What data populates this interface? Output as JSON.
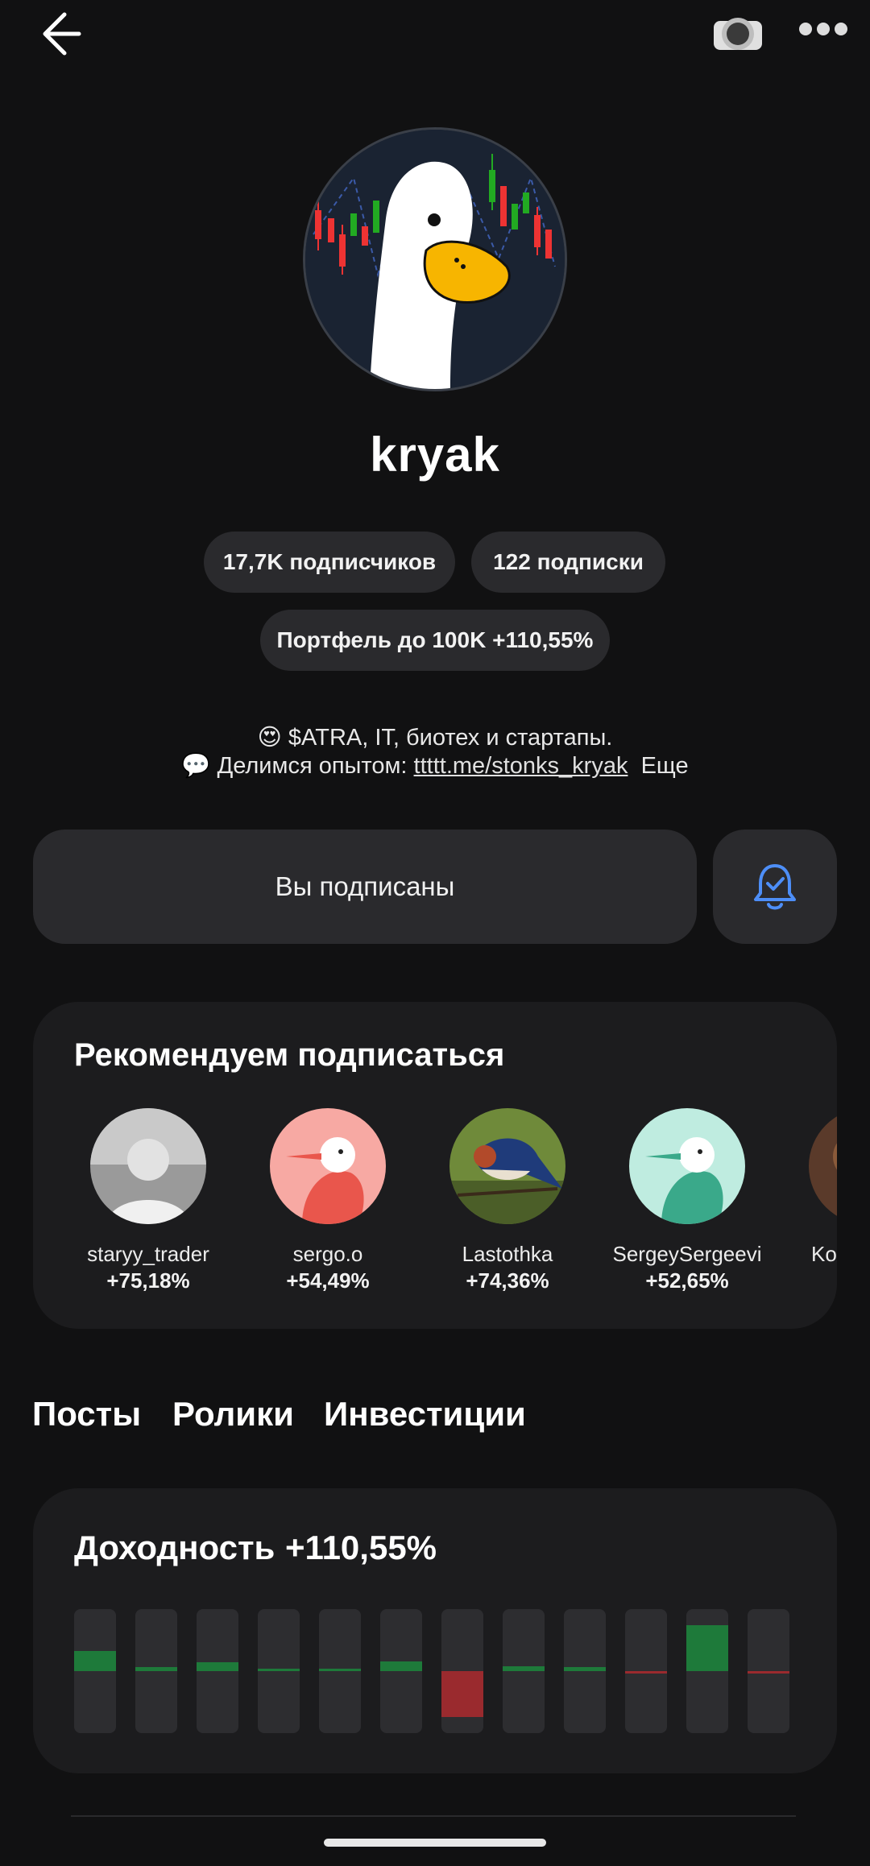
{
  "header": {
    "back_icon": "arrow-left-icon",
    "camera_icon": "camera-icon",
    "more_icon": "more-dots-icon"
  },
  "profile": {
    "username": "kryak",
    "followers": "17,7K подписчиков",
    "following": "122 подписки",
    "portfolio_label": "Портфель до 100K",
    "portfolio_gain": "+110,55%",
    "bio_line1_emoji": "😍",
    "bio_line1": "$ATRA, IT, биотех и стартапы.",
    "bio_line2_emoji": "💬",
    "bio_line2_prefix": "Делимся опытом:",
    "bio_link": "ttttt.me/stonks_kryak",
    "more_label": "Еще"
  },
  "actions": {
    "subscribed_label": "Вы подписаны",
    "bell_icon": "bell-check-icon"
  },
  "recommendations": {
    "title": "Рекомендуем подписаться",
    "items": [
      {
        "name": "staryy_trader",
        "gain": "+75,18%",
        "avatar": "photo-man"
      },
      {
        "name": "sergo.o",
        "gain": "+54,49%",
        "avatar": "bird-pink"
      },
      {
        "name": "Lastothka",
        "gain": "+74,36%",
        "avatar": "swallow-photo"
      },
      {
        "name": "SergeySergeevi",
        "gain": "+52,65%",
        "avatar": "bird-teal"
      },
      {
        "name": "Kons",
        "gain": "+",
        "avatar": "photo-partial"
      }
    ]
  },
  "tabs": [
    "Посты",
    "Ролики",
    "Инвестиции"
  ],
  "yield": {
    "title": "Доходность",
    "value": "+110,55%"
  },
  "chart_data": {
    "type": "bar",
    "title": "Доходность",
    "values": [
      0.16,
      0.03,
      0.07,
      0.01,
      0.01,
      0.08,
      -0.37,
      0.04,
      0.03,
      -0.02,
      0.37,
      -0.02
    ],
    "colors": {
      "positive": "#1e7a3a",
      "negative": "#9a2a2e"
    }
  }
}
